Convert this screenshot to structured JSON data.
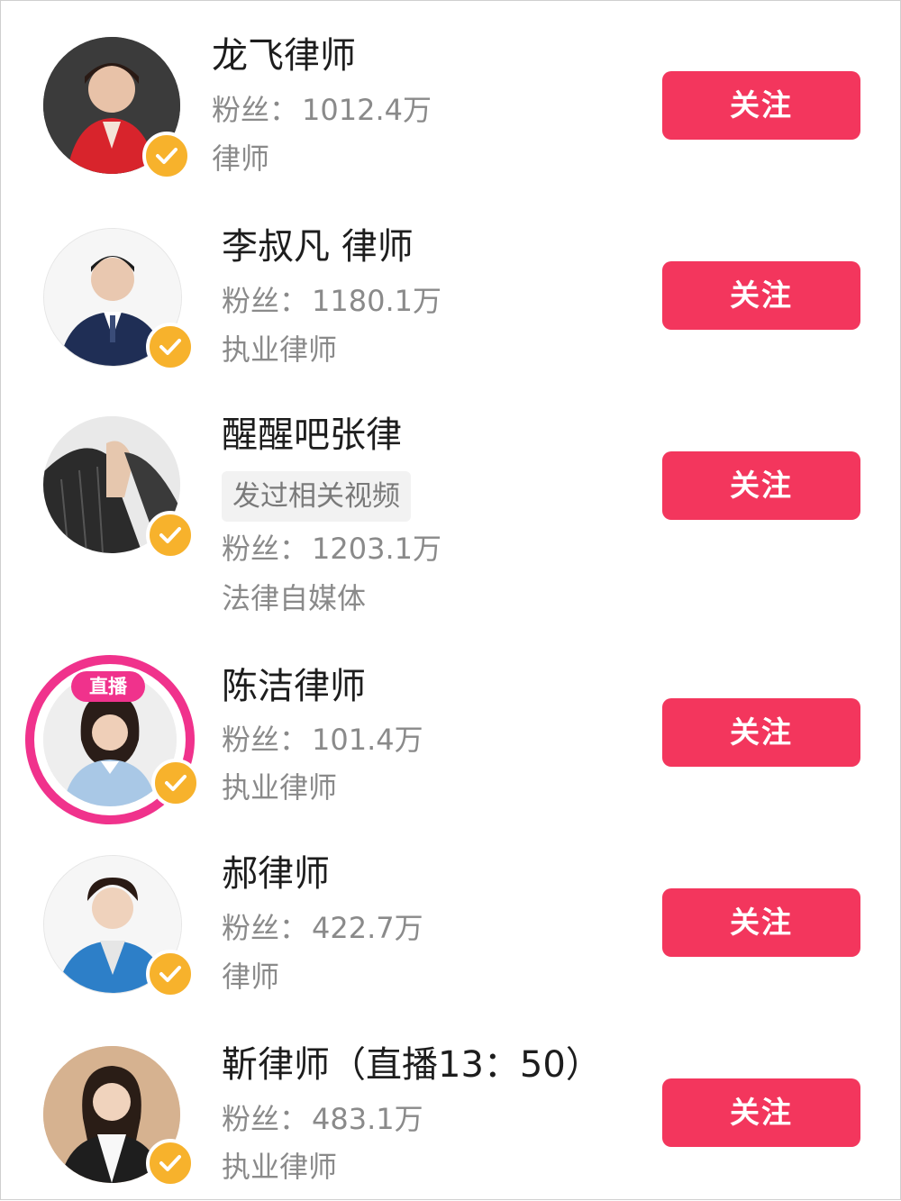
{
  "colors": {
    "follow_button": "#f3365d",
    "verified_badge": "#f7b22c",
    "live_ring": "#f0328c",
    "secondary_text": "#8a8a8a"
  },
  "fans_label": "粉丝：",
  "follow_label": "关注",
  "items": [
    {
      "name": "龙飞律师",
      "fans": "1012.4万",
      "role": "律师",
      "verified": true,
      "live": false
    },
    {
      "name": "李叔凡 律师",
      "fans": "1180.1万",
      "role": "执业律师",
      "verified": true,
      "live": false
    },
    {
      "name": "醒醒吧张律",
      "tag": "发过相关视频",
      "fans": "1203.1万",
      "role": "法律自媒体",
      "verified": true,
      "live": false
    },
    {
      "name": "陈洁律师",
      "fans": "101.4万",
      "role": "执业律师",
      "verified": true,
      "live": true,
      "live_label": "直播"
    },
    {
      "name": "郝律师",
      "fans": "422.7万",
      "role": "律师",
      "verified": true,
      "live": false
    },
    {
      "name": "靳律师（直播13：50）",
      "fans": "483.1万",
      "role": "执业律师",
      "verified": true,
      "live": false
    }
  ]
}
